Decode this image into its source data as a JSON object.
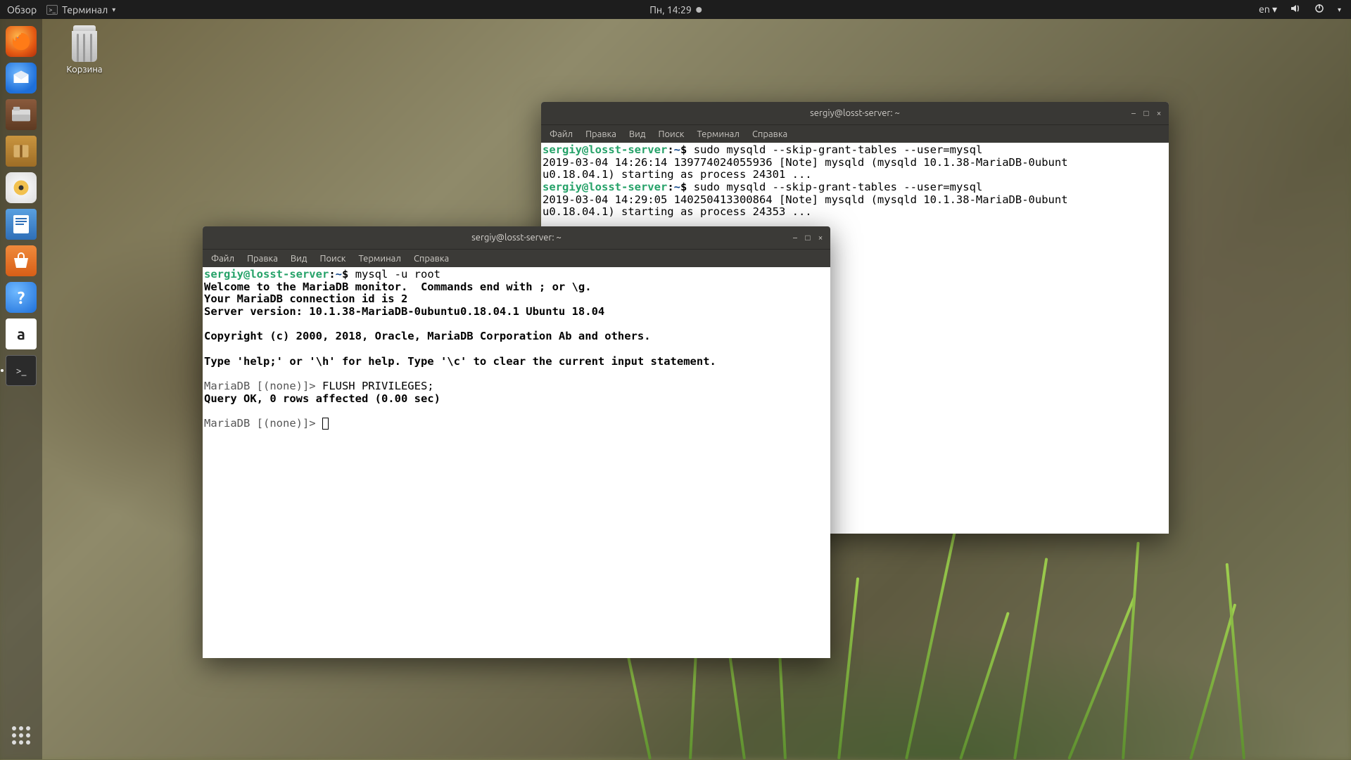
{
  "topbar": {
    "activities": "Обзор",
    "app_name": "Терминал",
    "clock": "Пн, 14:29",
    "lang": "en"
  },
  "desktop": {
    "trash_label": "Корзина"
  },
  "dock": {
    "items": [
      "firefox",
      "thunderbird",
      "files",
      "archive",
      "rhythmbox",
      "writer",
      "software",
      "help",
      "amazon",
      "terminal"
    ]
  },
  "menus": {
    "file": "Файл",
    "edit": "Правка",
    "view": "Вид",
    "search": "Поиск",
    "terminal": "Терминал",
    "help": "Справка"
  },
  "window_front": {
    "title": "sergiy@losst-server: ~",
    "prompt_user": "sergiy@losst-server",
    "prompt_path": "~",
    "cmd1": "mysql -u root",
    "lines": [
      "Welcome to the MariaDB monitor.  Commands end with ; or \\g.",
      "Your MariaDB connection id is 2",
      "Server version: 10.1.38-MariaDB-0ubuntu0.18.04.1 Ubuntu 18.04",
      "",
      "Copyright (c) 2000, 2018, Oracle, MariaDB Corporation Ab and others.",
      "",
      "Type 'help;' or '\\h' for help. Type '\\c' to clear the current input statement.",
      ""
    ],
    "mdb_prompt": "MariaDB [(none)]> ",
    "mdb_cmd1": "FLUSH PRIVILEGES;",
    "mdb_res1": "Query OK, 0 rows affected (0.00 sec)"
  },
  "window_back": {
    "title": "sergiy@losst-server: ~",
    "prompt_user": "sergiy@losst-server",
    "prompt_path": "~",
    "cmd1": "sudo mysqld --skip-grant-tables --user=mysql",
    "out1a": "2019-03-04 14:26:14 139774024055936 [Note] mysqld (mysqld 10.1.38-MariaDB-0ubunt",
    "out1b": "u0.18.04.1) starting as process 24301 ...",
    "cmd2": "sudo mysqld --skip-grant-tables --user=mysql",
    "out2a": "2019-03-04 14:29:05 140250413300864 [Note] mysqld (mysqld 10.1.38-MariaDB-0ubunt",
    "out2b": "u0.18.04.1) starting as process 24353 ..."
  }
}
